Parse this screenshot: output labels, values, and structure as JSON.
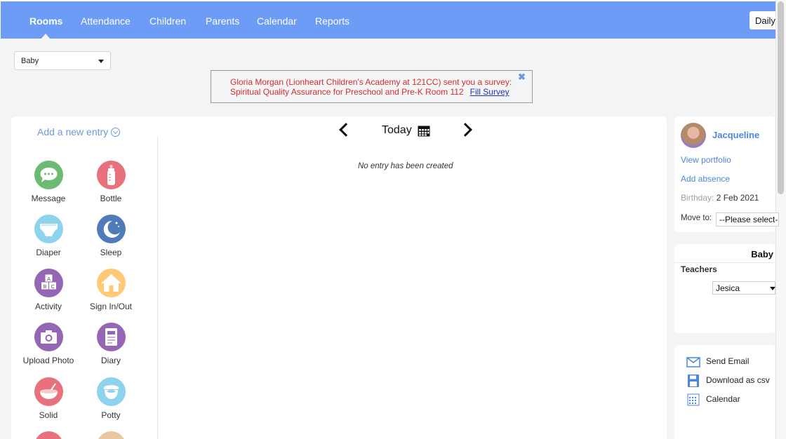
{
  "nav": {
    "items": [
      {
        "label": "Rooms",
        "active": true
      },
      {
        "label": "Attendance",
        "active": false
      },
      {
        "label": "Children",
        "active": false
      },
      {
        "label": "Parents",
        "active": false
      },
      {
        "label": "Calendar",
        "active": false
      },
      {
        "label": "Reports",
        "active": false
      }
    ],
    "view_button": "Daily",
    "color": "#6c9cf5"
  },
  "room_selector": {
    "value": "Baby"
  },
  "survey": {
    "line1": "Gloria Morgan (Lionheart Children's Academy at 121CC) sent you a survey:",
    "line2": "Spiritual Quality Assurance for Preschool and Pre-K Room 112",
    "link": "Fill Survey",
    "close": "✖"
  },
  "entries": {
    "title": "Add a new entry",
    "items": [
      {
        "label": "Message",
        "icon": "message-icon",
        "color": "#6dbb73"
      },
      {
        "label": "Bottle",
        "icon": "bottle-icon",
        "color": "#e7727d"
      },
      {
        "label": "Diaper",
        "icon": "diaper-icon",
        "color": "#8dd3ee"
      },
      {
        "label": "Sleep",
        "icon": "sleep-icon",
        "color": "#4f7bb8"
      },
      {
        "label": "Activity",
        "icon": "activity-icon",
        "color": "#9466b3"
      },
      {
        "label": "Sign In/Out",
        "icon": "house-icon",
        "color": "#ffc976"
      },
      {
        "label": "Upload Photo",
        "icon": "camera-icon",
        "color": "#9466b3"
      },
      {
        "label": "Diary",
        "icon": "diary-icon",
        "color": "#9466b3"
      },
      {
        "label": "Solid",
        "icon": "bowl-icon",
        "color": "#e7727d"
      },
      {
        "label": "Potty",
        "icon": "potty-icon",
        "color": "#8dd3ee"
      }
    ]
  },
  "timeline": {
    "date_label": "Today",
    "empty_text": "No entry has been created"
  },
  "child": {
    "name": "Jacqueline",
    "view_portfolio": "View portfolio",
    "add_absence": "Add absence",
    "birthday_label": "Birthday:",
    "birthday": "2 Feb 2021",
    "move_label": "Move to:",
    "move_value": "--Please select--"
  },
  "room_card": {
    "name": "Baby",
    "teachers_label": "Teachers",
    "teacher": "Jesica"
  },
  "actions": [
    {
      "label": "Send Email",
      "icon": "envelope-icon"
    },
    {
      "label": "Download as csv",
      "icon": "floppy-disk-icon"
    },
    {
      "label": "Calendar",
      "icon": "calendar-icon"
    }
  ]
}
